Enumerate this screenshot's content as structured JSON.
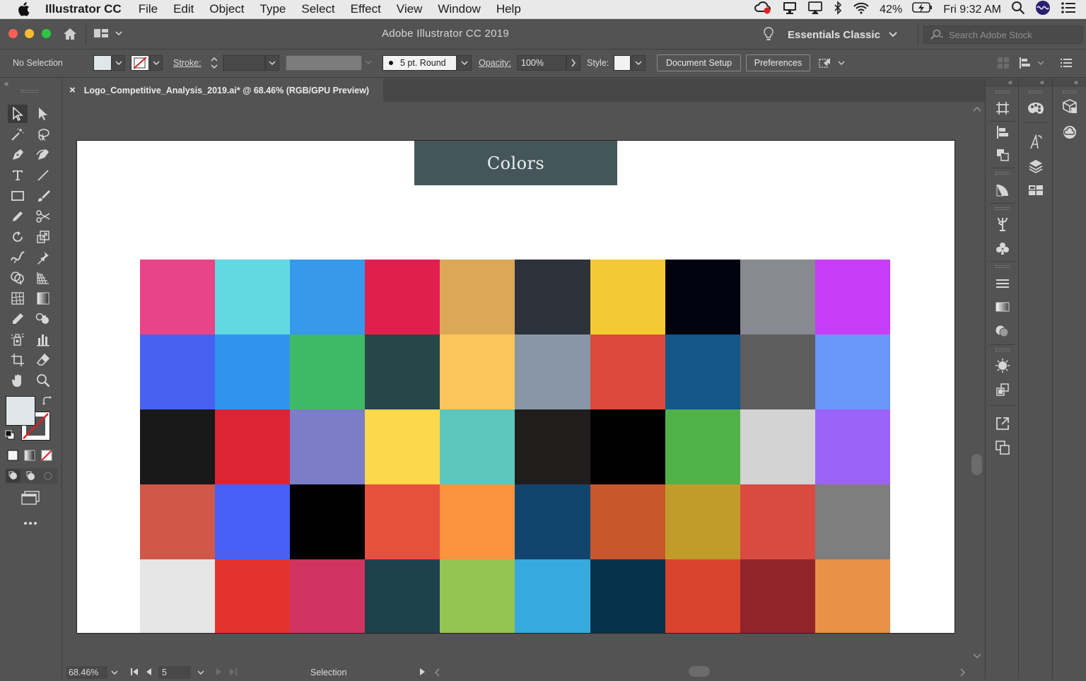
{
  "menubar": {
    "app_name": "Illustrator CC",
    "items": [
      "File",
      "Edit",
      "Object",
      "Type",
      "Select",
      "Effect",
      "View",
      "Window",
      "Help"
    ],
    "battery": "42%",
    "clock": "Fri 9:32 AM"
  },
  "appbar": {
    "title": "Adobe Illustrator CC 2019",
    "workspace": "Essentials Classic",
    "search_placeholder": "Search Adobe Stock"
  },
  "controlbar": {
    "selection": "No Selection",
    "stroke_label": "Stroke:",
    "brush": "5 pt. Round",
    "opacity_label": "Opacity:",
    "opacity_value": "100%",
    "style_label": "Style:",
    "document_setup": "Document Setup",
    "preferences": "Preferences"
  },
  "tab": {
    "close": "×",
    "title": "Logo_Competitive_Analysis_2019.ai* @ 68.46% (RGB/GPU Preview)"
  },
  "artboard": {
    "banner": "Colors",
    "swatches": [
      "#e84488",
      "#62d8e3",
      "#3699ea",
      "#e11f4f",
      "#dba858",
      "#2d323b",
      "#f4ca34",
      "#02030e",
      "#878a91",
      "#c73cf6",
      "#4762f1",
      "#3094ec",
      "#3eb965",
      "#27464a",
      "#fbc55b",
      "#8896a8",
      "#db4a3d",
      "#135789",
      "#5d5d5d",
      "#6997fa",
      "#191919",
      "#dc2436",
      "#7d7cc9",
      "#fed84b",
      "#5dc7be",
      "#211d1d",
      "#000000",
      "#52b24a",
      "#d3d3d3",
      "#9c63f8",
      "#cf5848",
      "#4660f7",
      "#000000",
      "#e8503e",
      "#fa943e",
      "#12456d",
      "#c8572d",
      "#c29c2a",
      "#d94b41",
      "#7e7e7e",
      "#e6e6e6",
      "#e4332f",
      "#cf3560",
      "#1d424d",
      "#94c453",
      "#38a9dc",
      "#053249",
      "#da432e",
      "#902429",
      "#e99146"
    ]
  },
  "statusbar": {
    "zoom": "68.46%",
    "artboard_number": "5",
    "tool": "Selection"
  },
  "colors": {
    "fill_swatch": "#dfe7ea",
    "none_red": "#e02020"
  }
}
